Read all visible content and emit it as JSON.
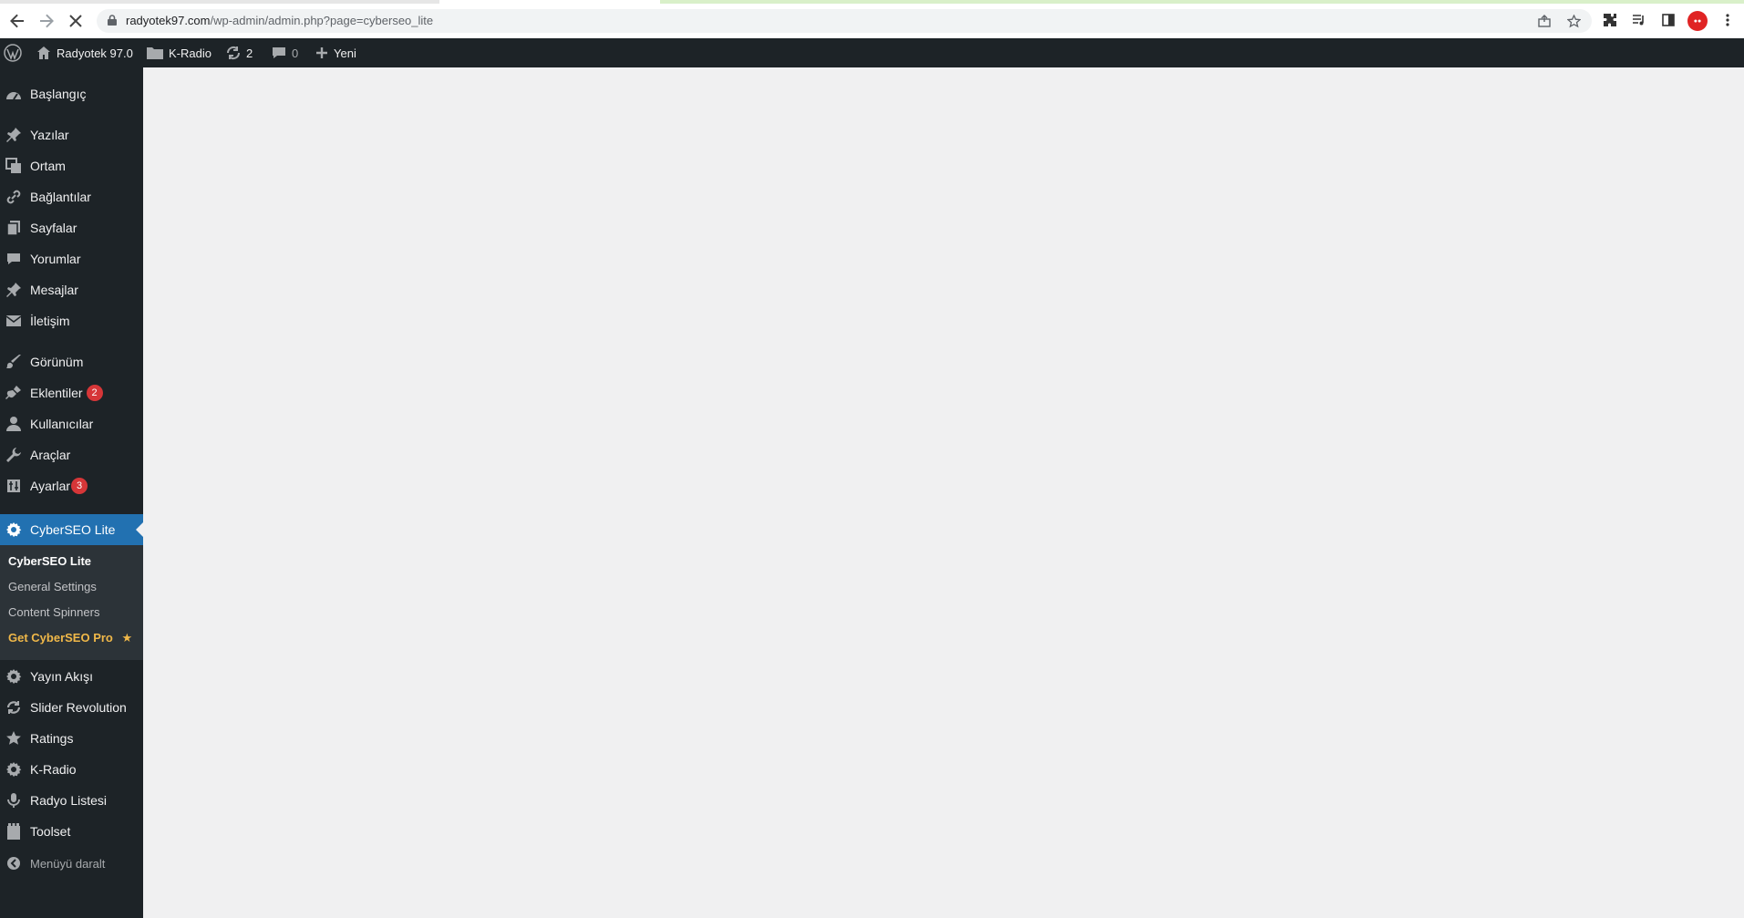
{
  "browser": {
    "url_host": "radyotek97.com",
    "url_path": "/wp-admin/admin.php?page=cyberseo_lite",
    "icons": [
      "back-arrow-icon",
      "forward-arrow-icon",
      "stop-loading-icon",
      "lock-icon",
      "share-icon",
      "star-icon",
      "extensions-icon",
      "media-queue-icon",
      "side-panel-icon",
      "profile-avatar",
      "menu-dots-icon"
    ]
  },
  "adminbar": {
    "site_name": "Radyotek 97.0",
    "k_radio": "K-Radio",
    "updates_count": "2",
    "comments_count": "0",
    "new_label": "Yeni"
  },
  "sidebar": {
    "items": [
      {
        "label": "Başlangıç",
        "icon": "dashboard-icon"
      },
      {
        "label": "Yazılar",
        "icon": "pin-icon"
      },
      {
        "label": "Ortam",
        "icon": "media-icon"
      },
      {
        "label": "Bağlantılar",
        "icon": "link-icon"
      },
      {
        "label": "Sayfalar",
        "icon": "pages-icon"
      },
      {
        "label": "Yorumlar",
        "icon": "comment-icon"
      },
      {
        "label": "Mesajlar",
        "icon": "pin-icon"
      },
      {
        "label": "İletişim",
        "icon": "mail-icon"
      },
      {
        "label": "Görünüm",
        "icon": "brush-icon"
      },
      {
        "label": "Eklentiler",
        "icon": "plugin-icon",
        "badge": "2"
      },
      {
        "label": "Kullanıcılar",
        "icon": "user-icon"
      },
      {
        "label": "Araçlar",
        "icon": "wrench-icon"
      },
      {
        "label": "Ayarlar",
        "icon": "settings-icon",
        "badge": "3"
      },
      {
        "label": "CyberSEO Lite",
        "icon": "gear-icon",
        "active": true
      },
      {
        "label": "Yayın Akışı",
        "icon": "gear-icon"
      },
      {
        "label": "Slider Revolution",
        "icon": "refresh-icon"
      },
      {
        "label": "Ratings",
        "icon": "star-icon"
      },
      {
        "label": "K-Radio",
        "icon": "gear-icon"
      },
      {
        "label": "Radyo Listesi",
        "icon": "microphone-icon"
      },
      {
        "label": "Toolset",
        "icon": "toolset-icon"
      }
    ],
    "submenu": {
      "current": "CyberSEO Lite",
      "general": "General Settings",
      "spinners": "Content Spinners",
      "pro": "Get CyberSEO Pro",
      "pro_star": "★"
    },
    "collapse_label": "Menüyü daralt"
  },
  "colors": {
    "admin_dark": "#1d2327",
    "active_blue": "#2271b1",
    "badge_red": "#d63638",
    "pro_gold": "#f0b849",
    "content_bg": "#f0f0f1"
  }
}
